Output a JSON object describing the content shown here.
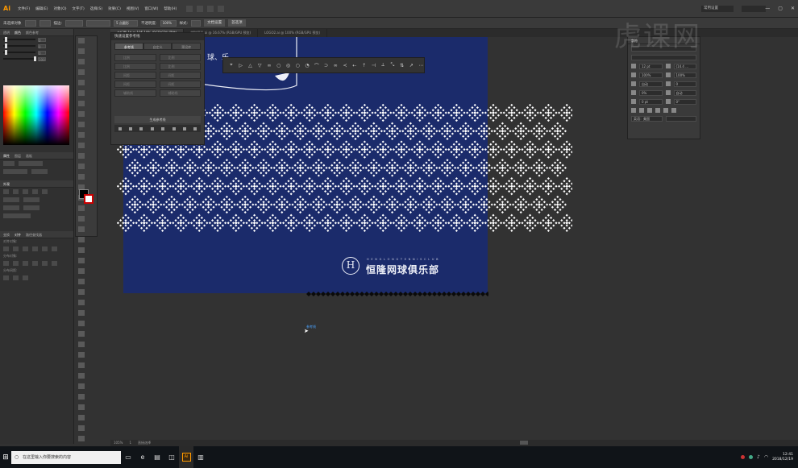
{
  "app": {
    "logo": "Ai",
    "menu": [
      "文件(F)",
      "编辑(E)",
      "对象(O)",
      "文字(T)",
      "选择(S)",
      "效果(C)",
      "视图(V)",
      "窗口(W)",
      "帮助(H)"
    ],
    "workspace": "常用设置",
    "window_controls": [
      "—",
      "▢",
      "✕"
    ]
  },
  "control_bar": {
    "selection_label": "未选择对象",
    "stroke_label": "描边:",
    "point_label": "5 点圆形",
    "opacity_label": "不透明度:",
    "opacity_value": "100%",
    "style_label": "样式:",
    "doc_setup_button": "文档设置",
    "prefs_button": "首选项"
  },
  "tabs": [
    {
      "label": "未标题-1* @ 105.19% (RGB/GPU 预览)",
      "active": true
    },
    {
      "label": "辅助图形.ai @ 16.67% (RGB/GPU 预览)",
      "active": false
    },
    {
      "label": "LOGO2.ai @ 100% (RGB/GPU 预览)",
      "active": false
    }
  ],
  "left_panels": {
    "color_tabs": [
      "透明",
      "颜色",
      "颜色参考"
    ],
    "appearance_tabs": [
      "属性",
      "图层",
      "画板"
    ],
    "appearance_title": "外观",
    "align_tabs": [
      "变换",
      "对齐",
      "路径查找器"
    ],
    "align_labels": [
      "对齐对象:",
      "分布对象:",
      "分布间距:",
      "对齐:"
    ],
    "channel_values": [
      "0",
      "0",
      "0",
      "100"
    ]
  },
  "guides_panel": {
    "title": "快速设置参考线",
    "tabs": [
      "参考线",
      "自定义",
      "预设库"
    ],
    "items": [
      "比例",
      "比例",
      "比例",
      "比例",
      "间距",
      "间距",
      "间距",
      "间距",
      "辅助线",
      "辅助线"
    ],
    "generate_button": "生成参考线"
  },
  "artwork": {
    "club_en": "H E N G  L O N G  T E N N I S  C L U B",
    "club_zh": "恒隆网球俱乐部",
    "logo_letter": "H",
    "partial_text": "球、乐"
  },
  "floating_toolbar": {
    "icons": [
      "⌖",
      "▷",
      "△",
      "▽",
      "∞",
      "○",
      "◎",
      "○",
      "◔",
      "⌒",
      "⊃",
      "∞",
      "≺",
      "⇠",
      "⇡",
      "⊣",
      "⟂",
      "⤡",
      "⇅",
      "↗",
      "⋯"
    ]
  },
  "char_panel": {
    "title": "字符",
    "font_size": "12 pt",
    "leading": "(14.4 ... ",
    "hscale": "100%",
    "vscale": "100%",
    "tracking": "0",
    "kerning": "自动",
    "baseline": "0 pt",
    "rotation": "0°",
    "lang": "英语：美国",
    "percent": "0%"
  },
  "watermark": "虎课网",
  "cursor_label": "参考线",
  "status": {
    "zoom": "105%",
    "page": "1",
    "tool": "直接选择"
  },
  "taskbar": {
    "search_placeholder": "在这里输入你要搜索的内容",
    "time": "12:41",
    "date": "2018/12/19"
  },
  "colors": {
    "artboard": "#1b2b6b",
    "accent": "#ff9a00",
    "pattern": "#ffffff"
  }
}
